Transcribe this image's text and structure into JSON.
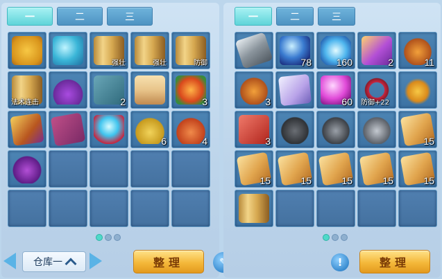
{
  "left": {
    "tabs": [
      "一",
      "二",
      "三"
    ],
    "active_tab": 0,
    "slots": [
      {
        "icon": "seal-token-icon",
        "art": "a-seal",
        "count": "",
        "tag": ""
      },
      {
        "icon": "sea-dragon-icon",
        "art": "a-dragon",
        "count": "",
        "tag": ""
      },
      {
        "icon": "scroll-icon",
        "art": "a-scroll",
        "count": "",
        "tag": "强壮"
      },
      {
        "icon": "scroll-icon",
        "art": "a-scroll",
        "count": "",
        "tag": "强壮"
      },
      {
        "icon": "scroll-icon",
        "art": "a-scroll",
        "count": "",
        "tag": "防御"
      },
      {
        "icon": "scroll-icon",
        "art": "a-scroll",
        "count": "",
        "tag": "法术连击",
        "tag_left": true
      },
      {
        "icon": "potion-bottle-icon",
        "art": "a-potion",
        "count": "",
        "tag": ""
      },
      {
        "icon": "book-icon",
        "art": "a-book",
        "count": "2",
        "tag": ""
      },
      {
        "icon": "pastry-icon",
        "art": "a-cake",
        "count": "",
        "tag": ""
      },
      {
        "icon": "lantern-icon",
        "art": "a-lantern",
        "count": "3",
        "tag": ""
      },
      {
        "icon": "talisman-card-icon",
        "art": "a-card",
        "count": "",
        "tag": ""
      },
      {
        "icon": "red-book-icon",
        "art": "a-redbook",
        "count": "",
        "tag": ""
      },
      {
        "icon": "crystal-orb-icon",
        "art": "a-orb",
        "count": "",
        "tag": ""
      },
      {
        "icon": "gourd-icon",
        "art": "a-gourd",
        "count": "6",
        "tag": ""
      },
      {
        "icon": "pouch-icon",
        "art": "a-pouch",
        "count": "4",
        "tag": ""
      },
      {
        "icon": "purple-bag-icon",
        "art": "a-purplebag",
        "count": "",
        "tag": ""
      },
      {
        "empty": true
      },
      {
        "empty": true
      },
      {
        "empty": true
      },
      {
        "empty": true
      },
      {
        "empty": true
      },
      {
        "empty": true
      },
      {
        "empty": true
      },
      {
        "empty": true
      },
      {
        "empty": true
      }
    ],
    "page_dots": [
      true,
      false,
      false
    ]
  },
  "right": {
    "tabs": [
      "一",
      "二",
      "三"
    ],
    "active_tab": 0,
    "slots": [
      {
        "icon": "iron-ingot-icon",
        "art": "a-ingot",
        "count": "",
        "tag": ""
      },
      {
        "icon": "blue-sphere-icon",
        "art": "a-sphere",
        "count": "78",
        "tag": ""
      },
      {
        "icon": "swirl-orb-icon",
        "art": "a-swirl",
        "count": "160",
        "tag": ""
      },
      {
        "icon": "character-card-icon",
        "art": "a-girlcard",
        "count": "2",
        "tag": ""
      },
      {
        "icon": "treasure-bag-icon",
        "art": "a-treasure",
        "count": "11",
        "tag": ""
      },
      {
        "icon": "treasure-bag-icon",
        "art": "a-treasure",
        "count": "3",
        "tag": ""
      },
      {
        "icon": "pet-card-icon",
        "art": "a-flyer",
        "count": "",
        "tag": ""
      },
      {
        "icon": "pink-pearl-icon",
        "art": "a-pearl",
        "count": "60",
        "tag": ""
      },
      {
        "icon": "necklace-icon",
        "art": "a-necklace",
        "count": "",
        "tag": "防御+22",
        "tag_left": true
      },
      {
        "icon": "amulet-icon",
        "art": "a-amulet",
        "count": "",
        "tag": ""
      },
      {
        "icon": "red-book-icon",
        "art": "a-redbook2",
        "count": "3",
        "tag": ""
      },
      {
        "icon": "iron-pot-icon",
        "art": "a-pot",
        "count": "",
        "tag": ""
      },
      {
        "icon": "cauldron-icon",
        "art": "a-cauldron",
        "count": "",
        "tag": ""
      },
      {
        "icon": "tripod-icon",
        "art": "a-tripod",
        "count": "",
        "tag": ""
      },
      {
        "icon": "treasure-map-icon",
        "art": "a-map",
        "count": "15",
        "tag": ""
      },
      {
        "icon": "treasure-map-icon",
        "art": "a-map",
        "count": "15",
        "tag": ""
      },
      {
        "icon": "treasure-map-icon",
        "art": "a-map",
        "count": "15",
        "tag": ""
      },
      {
        "icon": "treasure-map-icon",
        "art": "a-map",
        "count": "15",
        "tag": ""
      },
      {
        "icon": "treasure-map-icon",
        "art": "a-map",
        "count": "15",
        "tag": ""
      },
      {
        "icon": "treasure-map-icon",
        "art": "a-map",
        "count": "15",
        "tag": ""
      },
      {
        "icon": "scroll-icon",
        "art": "a-scroll",
        "count": "",
        "tag": ""
      },
      {
        "empty": true
      },
      {
        "empty": true
      },
      {
        "empty": true
      },
      {
        "empty": true
      }
    ],
    "page_dots": [
      true,
      false,
      false
    ]
  },
  "bottom": {
    "storage_label": "仓库一",
    "sort_label_left": "整理",
    "sort_label_right": "整理",
    "info_glyph": "!",
    "edit_glyph": "✎"
  },
  "colors": {
    "active_tab": "#5fd4d9",
    "slot": "#4d85b4",
    "sort_button": "#f4b83a",
    "page_dot_active": "#4fd9c9"
  }
}
